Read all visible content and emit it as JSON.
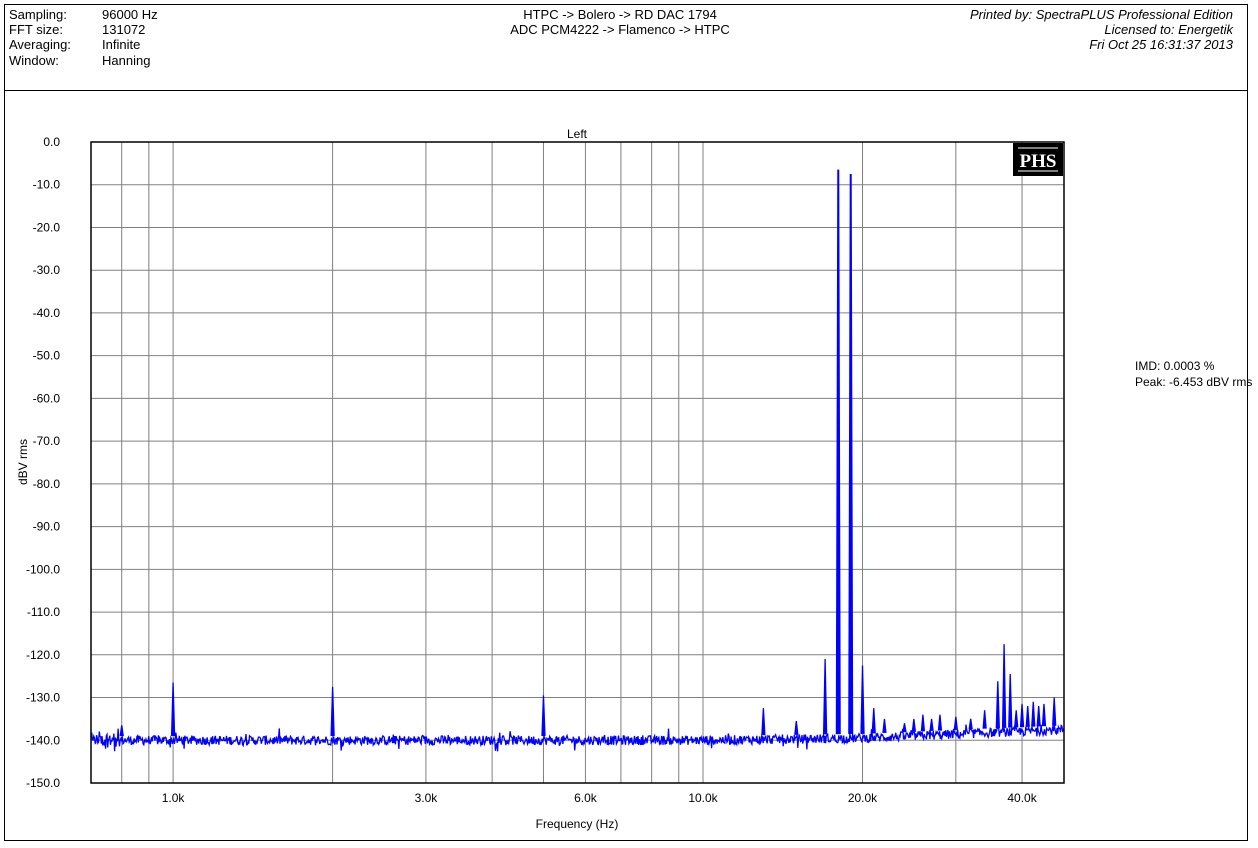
{
  "header": {
    "settings": [
      {
        "label": "Sampling:",
        "value": "96000 Hz"
      },
      {
        "label": "FFT size:",
        "value": "131072"
      },
      {
        "label": "Averaging:",
        "value": "Infinite"
      },
      {
        "label": "Window:",
        "value": "Hanning"
      }
    ],
    "chain_line1": "HTPC -> Bolero -> RD DAC 1794",
    "chain_line2": "ADC PCM4222 -> Flamenco -> HTPC",
    "printed_by": "Printed by: SpectraPLUS Professional Edition",
    "licensed_to": "Licensed to: Energetik",
    "date": "Fri Oct 25 16:31:37 2013"
  },
  "logo": "PHS",
  "readouts": {
    "imd": "IMD: 0.0003 %",
    "peak": "Peak: -6.453 dBV rms"
  },
  "chart_data": {
    "type": "line",
    "title": "Left",
    "xlabel": "Frequency (Hz)",
    "ylabel": "dBV rms",
    "xscale": "log",
    "xlim": [
      700,
      48000
    ],
    "ylim": [
      -150,
      0
    ],
    "grid": true,
    "color": "#0000ff",
    "x_ticks": [
      {
        "v": 1000,
        "label": "1.0k"
      },
      {
        "v": 3000,
        "label": "3.0k"
      },
      {
        "v": 6000,
        "label": "6.0k"
      },
      {
        "v": 10000,
        "label": "10.0k"
      },
      {
        "v": 20000,
        "label": "20.0k"
      },
      {
        "v": 40000,
        "label": "40.0k"
      }
    ],
    "x_gridlines": [
      800,
      900,
      1000,
      2000,
      3000,
      4000,
      5000,
      6000,
      7000,
      8000,
      9000,
      10000,
      20000,
      30000,
      40000
    ],
    "y_ticks": [
      "0.0",
      "-10.0",
      "-20.0",
      "-30.0",
      "-40.0",
      "-50.0",
      "-60.0",
      "-70.0",
      "-80.0",
      "-90.0",
      "-100.0",
      "-110.0",
      "-120.0",
      "-130.0",
      "-140.0",
      "-150.0"
    ],
    "noise_floor": [
      {
        "f": 700,
        "db": -140
      },
      {
        "f": 10000,
        "db": -140
      },
      {
        "f": 20000,
        "db": -139.5
      },
      {
        "f": 48000,
        "db": -137.5
      }
    ],
    "peaks": [
      {
        "f": 800,
        "db": -136.5
      },
      {
        "f": 1000,
        "db": -126.5
      },
      {
        "f": 2000,
        "db": -127.5
      },
      {
        "f": 5000,
        "db": -129.5
      },
      {
        "f": 13000,
        "db": -132.5
      },
      {
        "f": 15000,
        "db": -135.5
      },
      {
        "f": 17000,
        "db": -121
      },
      {
        "f": 18000,
        "db": -6.453
      },
      {
        "f": 19000,
        "db": -7.5
      },
      {
        "f": 20000,
        "db": -122.5
      },
      {
        "f": 21000,
        "db": -132.5
      },
      {
        "f": 22000,
        "db": -135
      },
      {
        "f": 24000,
        "db": -136
      },
      {
        "f": 25000,
        "db": -135
      },
      {
        "f": 26000,
        "db": -134
      },
      {
        "f": 27000,
        "db": -135
      },
      {
        "f": 28000,
        "db": -134
      },
      {
        "f": 30000,
        "db": -134.5
      },
      {
        "f": 32000,
        "db": -135
      },
      {
        "f": 34000,
        "db": -133
      },
      {
        "f": 36000,
        "db": -126.2
      },
      {
        "f": 37000,
        "db": -117.5
      },
      {
        "f": 38000,
        "db": -124.5
      },
      {
        "f": 39000,
        "db": -133
      },
      {
        "f": 40000,
        "db": -131.5
      },
      {
        "f": 41000,
        "db": -132
      },
      {
        "f": 42000,
        "db": -131
      },
      {
        "f": 43000,
        "db": -132
      },
      {
        "f": 44000,
        "db": -131.5
      },
      {
        "f": 46000,
        "db": -130
      }
    ]
  }
}
